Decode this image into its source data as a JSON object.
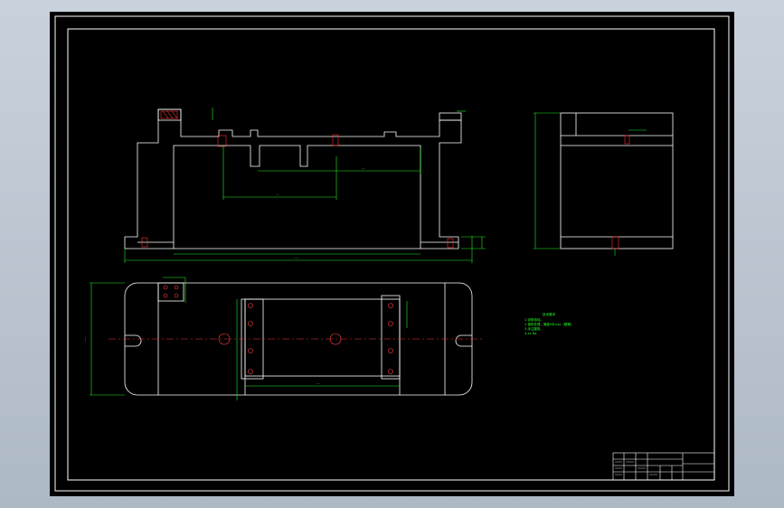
{
  "drawing": {
    "background": "#000000",
    "colors": {
      "outline": "#ffffff",
      "dimension": "#22ee22",
      "centerline": "#ff3030",
      "hole": "#ff4040",
      "frame": "#ffffff"
    },
    "notes": {
      "title": "技术要求",
      "lines": [
        "1.锐角倒钝。",
        "2.调质处理，硬度HB-xxx（模糊）",
        "3.未注圆角。",
        "4.xx Ra."
      ]
    },
    "dimension_labels": {
      "front_overall": "———",
      "front_inner": "——",
      "front_depth": "——",
      "plan_width": "———",
      "plan_inner": "——"
    }
  }
}
